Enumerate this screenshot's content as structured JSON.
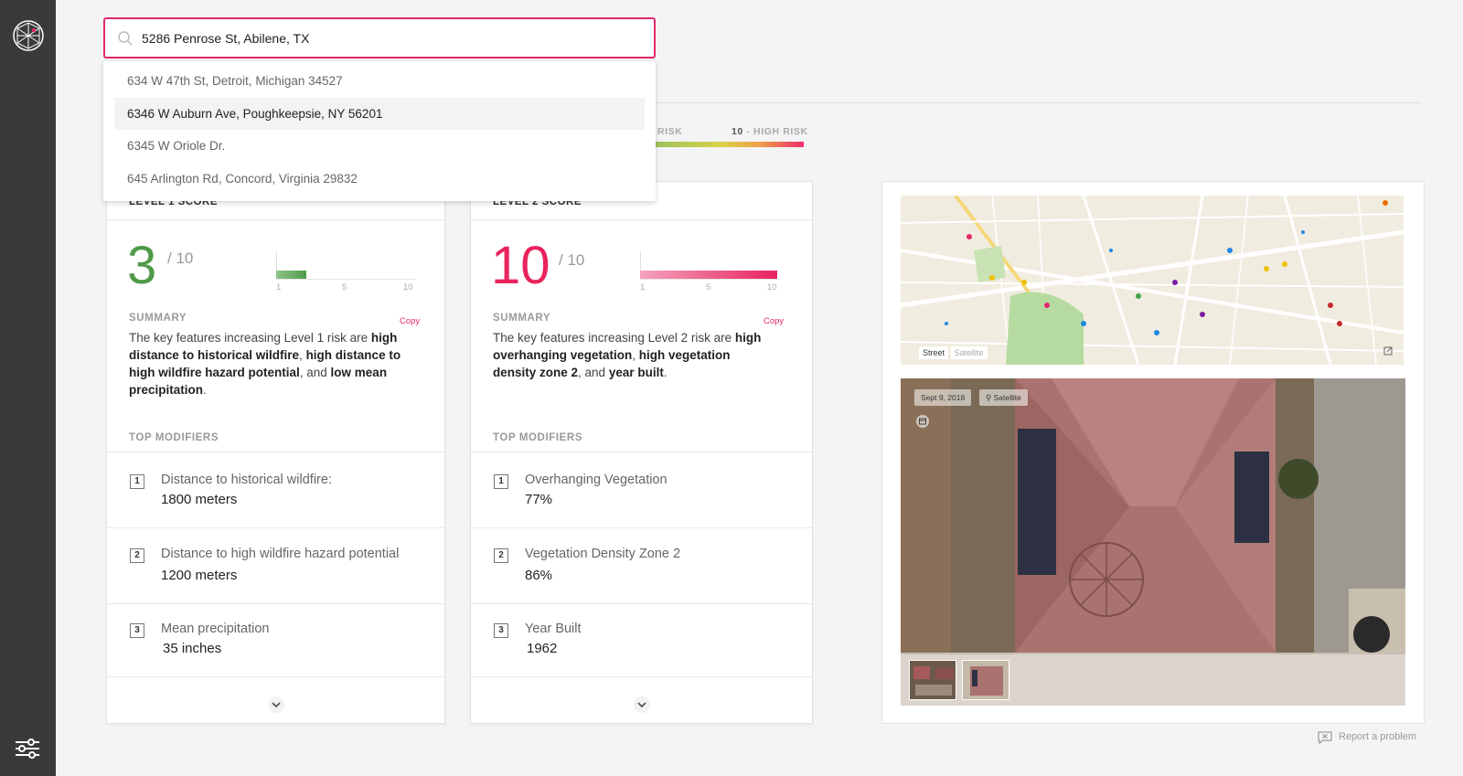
{
  "sidebar": {
    "logo_icon": "globe-mesh-logo",
    "settings_icon": "sliders-icon"
  },
  "search": {
    "value": "5286 Penrose St, Abilene, TX",
    "placeholder": ""
  },
  "suggestions": [
    "634 W 47th St, Detroit, Michigan 34527",
    "6346 W Auburn Ave, Poughkeepsie, NY 56201",
    "6345 W Oriole Dr.",
    "645 Arlington Rd, Concord, Virginia 29832"
  ],
  "active_suggestion_index": 1,
  "risk_legend": {
    "low_suffix": "RISK",
    "high_num": "10",
    "high_label": "- HIGH RISK"
  },
  "level1": {
    "title": "LEVEL 1 SCORE",
    "score": "3",
    "out_of": "/ 10",
    "score_value": 3,
    "ticks": [
      "1",
      "5",
      "10"
    ],
    "summary_label": "SUMMARY",
    "copy_label": "Copy",
    "summary_parts": {
      "p1": "The key features increasing Level 1 risk are ",
      "b1": "high distance to historical wildfire",
      "p2": ", ",
      "b2": "high distance to high wildfire hazard potential",
      "p3": ", and ",
      "b3": "low mean precipitation",
      "p4": "."
    },
    "modifiers_label": "TOP MODIFIERS",
    "modifiers": [
      {
        "num": "1",
        "label": "Distance to historical wildfire:",
        "value": "1800 meters"
      },
      {
        "num": "2",
        "label": "Distance to high wildfire hazard potential",
        "value": "1200 meters"
      },
      {
        "num": "3",
        "label": "Mean precipitation",
        "value": "35 inches"
      }
    ]
  },
  "level2": {
    "title": "LEVEL 2 SCORE",
    "score": "10",
    "out_of": "/ 10",
    "score_value": 10,
    "ticks": [
      "1",
      "5",
      "10"
    ],
    "summary_label": "SUMMARY",
    "copy_label": "Copy",
    "summary_parts": {
      "p1": "The key features increasing Level 2 risk are ",
      "b1": "high overhanging vegetation",
      "p2": ", ",
      "b2": "high vegetation density zone 2",
      "p3": ", and ",
      "b3": "year built",
      "p4": "."
    },
    "modifiers_label": "TOP MODIFIERS",
    "modifiers": [
      {
        "num": "1",
        "label": "Overhanging Vegetation",
        "value": "77%"
      },
      {
        "num": "2",
        "label": "Vegetation Density Zone 2",
        "value": "86%"
      },
      {
        "num": "3",
        "label": "Year Built",
        "value": "1962"
      }
    ]
  },
  "map": {
    "tab_street": "Street",
    "tab_satellite": "Satellite"
  },
  "aerial": {
    "date_chip": "Sept 9, 2018",
    "source_chip": "Satellite"
  },
  "report": {
    "label": "Report a problem"
  },
  "colors": {
    "accent": "#e3286e",
    "low": "#4f9a48",
    "high": "#e8245e"
  }
}
